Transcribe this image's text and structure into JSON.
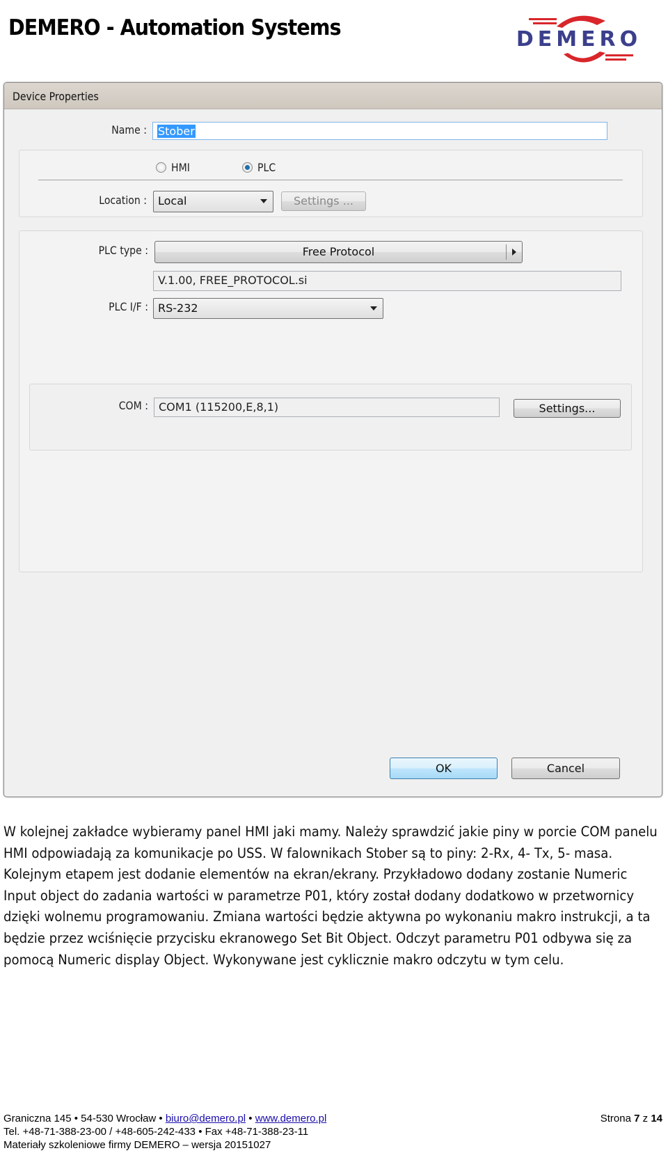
{
  "header": {
    "title": "DEMERO - Automation Systems",
    "logo_text": "DEMERO",
    "logo_colors": {
      "text": "#3b3f8c",
      "swoosh": "#d9262b"
    }
  },
  "dialog": {
    "title": "Device Properties",
    "name_label": "Name :",
    "name_value": "Stober",
    "radio_hmi": "HMI",
    "radio_plc": "PLC",
    "selected_type": "PLC",
    "location_label": "Location :",
    "location_value": "Local",
    "location_settings": "Settings ...",
    "plc_type_label": "PLC type :",
    "plc_type_value": "Free Protocol",
    "version_value": "V.1.00, FREE_PROTOCOL.si",
    "plc_if_label": "PLC I/F :",
    "plc_if_value": "RS-232",
    "com_label": "COM :",
    "com_value": "COM1 (115200,E,8,1)",
    "com_settings": "Settings...",
    "ok": "OK",
    "cancel": "Cancel"
  },
  "body_text": "W kolejnej zakładce wybieramy panel HMI jaki mamy. Należy sprawdzić jakie piny w porcie COM panelu HMI odpowiadają za komunikacje po USS. W falownikach Stober są to piny: 2-Rx, 4- Tx, 5- masa. Kolejnym etapem jest dodanie elementów na ekran/ekrany. Przykładowo dodany zostanie Numeric Input object do zadania wartości w parametrze P01, który został dodany dodatkowo w przetwornicy dzięki wolnemu programowaniu. Zmiana wartości będzie aktywna po wykonaniu makro instrukcji, a ta będzie przez wciśnięcie przycisku ekranowego Set Bit Object. Odczyt parametru P01 odbywa się za pomocą Numeric display Object. Wykonywane jest cyklicznie makro odczytu w tym celu.",
  "footer": {
    "address": "Graniczna 145 • 54-530 Wrocław • ",
    "email": "biuro@demero.pl",
    "sep": " • ",
    "website": "www.demero.pl",
    "page_prefix": "Strona ",
    "page_num": "7",
    "page_mid": " z ",
    "page_total": "14",
    "phones": "Tel. +48-71-388-23-00 / +48-605-242-433 • Fax +48-71-388-23-11",
    "version": "Materiały szkoleniowe firmy DEMERO – wersja 20151027"
  }
}
